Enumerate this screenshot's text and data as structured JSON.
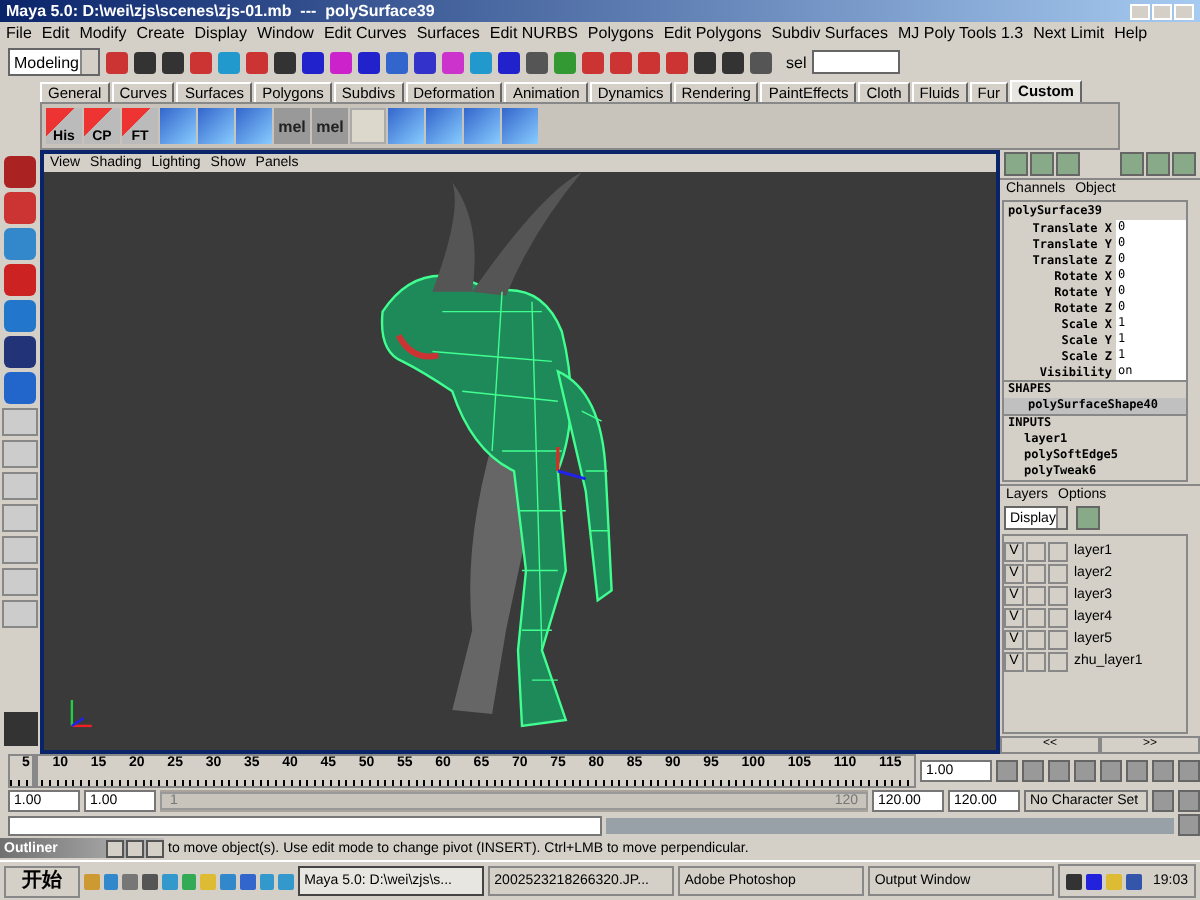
{
  "window": {
    "title": "Maya 5.0: D:\\wei\\zjs\\scenes\\zjs-01.mb  ---  polySurface39"
  },
  "menu": [
    "File",
    "Edit",
    "Modify",
    "Create",
    "Display",
    "Window",
    "Edit Curves",
    "Surfaces",
    "Edit NURBS",
    "Polygons",
    "Edit Polygons",
    "Subdiv Surfaces",
    "MJ Poly Tools 1.3",
    "Next Limit",
    "Help"
  ],
  "status_line": {
    "mode": "Modeling",
    "sel_label": "sel"
  },
  "shelf": {
    "tabs": [
      {
        "label": "General",
        "selected": false
      },
      {
        "label": "Curves",
        "selected": false
      },
      {
        "label": "Surfaces",
        "selected": false
      },
      {
        "label": "Polygons",
        "selected": false
      },
      {
        "label": "Subdivs",
        "selected": false
      },
      {
        "label": "Deformation",
        "selected": false
      },
      {
        "label": "Animation",
        "selected": false
      },
      {
        "label": "Dynamics",
        "selected": false
      },
      {
        "label": "Rendering",
        "selected": false
      },
      {
        "label": "PaintEffects",
        "selected": false
      },
      {
        "label": "Cloth",
        "selected": false
      },
      {
        "label": "Fluids",
        "selected": false
      },
      {
        "label": "Fur",
        "selected": false
      },
      {
        "label": "Custom",
        "selected": true
      }
    ],
    "buttons": [
      {
        "kind": "arrow",
        "label": "His"
      },
      {
        "kind": "arrow",
        "label": "CP"
      },
      {
        "kind": "arrow",
        "label": "FT"
      },
      {
        "kind": "icon"
      },
      {
        "kind": "icon"
      },
      {
        "kind": "icon"
      },
      {
        "kind": "text",
        "label": "mel"
      },
      {
        "kind": "text",
        "label": "mel"
      },
      {
        "kind": "blank"
      },
      {
        "kind": "icon"
      },
      {
        "kind": "icon"
      },
      {
        "kind": "icon"
      },
      {
        "kind": "icon"
      }
    ]
  },
  "viewport": {
    "menu": [
      "View",
      "Shading",
      "Lighting",
      "Show",
      "Panels"
    ]
  },
  "channel_box": {
    "tabs": [
      "Channels",
      "Object"
    ],
    "object": "polySurface39",
    "attributes": [
      {
        "name": "Translate X",
        "value": "0"
      },
      {
        "name": "Translate Y",
        "value": "0"
      },
      {
        "name": "Translate Z",
        "value": "0"
      },
      {
        "name": "Rotate X",
        "value": "0"
      },
      {
        "name": "Rotate Y",
        "value": "0"
      },
      {
        "name": "Rotate Z",
        "value": "0"
      },
      {
        "name": "Scale X",
        "value": "1"
      },
      {
        "name": "Scale Y",
        "value": "1"
      },
      {
        "name": "Scale Z",
        "value": "1"
      },
      {
        "name": "Visibility",
        "value": "on"
      }
    ],
    "shapes_header": "SHAPES",
    "shapes": [
      "polySurfaceShape40"
    ],
    "inputs_header": "INPUTS",
    "inputs": [
      "layer1",
      "polySoftEdge5",
      "polyTweak6"
    ]
  },
  "layers": {
    "menu": [
      "Layers",
      "Options"
    ],
    "display": "Display",
    "rows": [
      {
        "visible": "V",
        "name": "layer1"
      },
      {
        "visible": "V",
        "name": "layer2"
      },
      {
        "visible": "V",
        "name": "layer3"
      },
      {
        "visible": "V",
        "name": "layer4"
      },
      {
        "visible": "V",
        "name": "layer5"
      },
      {
        "visible": "V",
        "name": "zhu_layer1"
      }
    ],
    "scroll_buttons": [
      "<<",
      ">>"
    ]
  },
  "time_slider": {
    "ticks": [
      "5",
      "10",
      "15",
      "20",
      "25",
      "30",
      "35",
      "40",
      "45",
      "50",
      "55",
      "60",
      "65",
      "70",
      "75",
      "80",
      "85",
      "90",
      "95",
      "100",
      "105",
      "110",
      "115"
    ],
    "current_time": "1.00",
    "level": 0.01
  },
  "range_slider": {
    "start": "1.00",
    "playback_start": "1.00",
    "slider_start": "1",
    "slider_end": "120",
    "level": 1,
    "playback_end": "120.00",
    "end": "120.00",
    "character_set": "No Character Set"
  },
  "help_line": {
    "text": "to move object(s). Use edit mode to change pivot (INSERT).  Ctrl+LMB to move perpendicular.",
    "minimized_window": "Outliner"
  },
  "taskbar": {
    "start": "开始",
    "tasks": [
      {
        "label": "Maya 5.0: D:\\wei\\zjs\\s...",
        "selected": true
      },
      {
        "label": "2002523218266320.JP...",
        "selected": false
      },
      {
        "label": "Adobe Photoshop",
        "selected": false
      },
      {
        "label": "Output Window",
        "selected": false
      }
    ],
    "clock": "19:03"
  }
}
